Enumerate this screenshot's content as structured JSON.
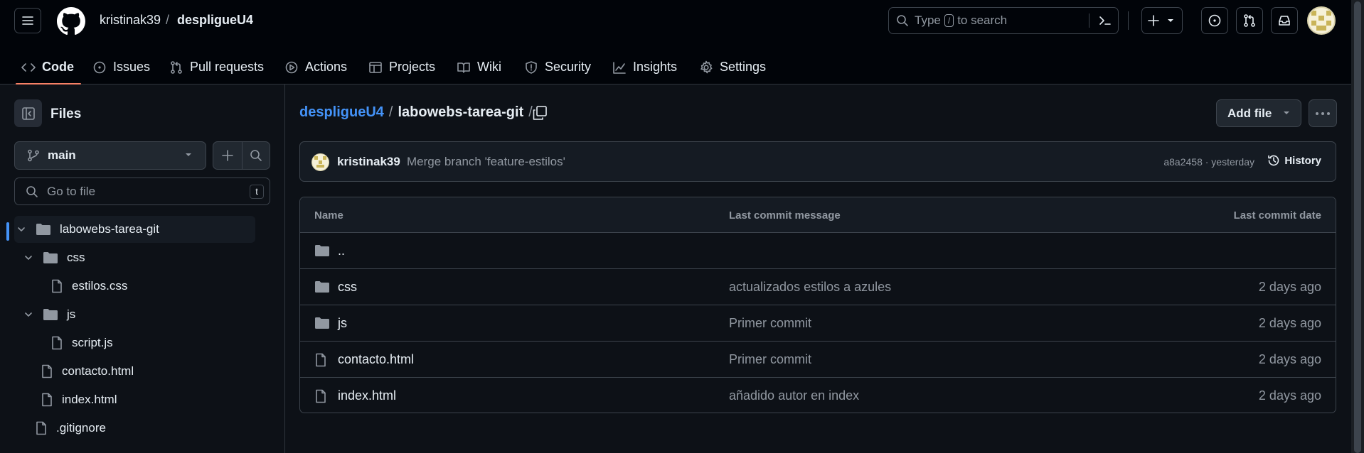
{
  "header": {
    "owner": "kristinak39",
    "separator": "/",
    "repo": "despligueU4",
    "search": {
      "prefix": "Type",
      "key": "/",
      "suffix": "to search"
    }
  },
  "tabs": [
    {
      "label": "Code",
      "icon": "code-icon"
    },
    {
      "label": "Issues",
      "icon": "issue-icon"
    },
    {
      "label": "Pull requests",
      "icon": "pull-request-icon"
    },
    {
      "label": "Actions",
      "icon": "play-icon"
    },
    {
      "label": "Projects",
      "icon": "table-icon"
    },
    {
      "label": "Wiki",
      "icon": "book-icon"
    },
    {
      "label": "Security",
      "icon": "shield-icon"
    },
    {
      "label": "Insights",
      "icon": "graph-icon"
    },
    {
      "label": "Settings",
      "icon": "gear-icon"
    }
  ],
  "sidebar": {
    "title": "Files",
    "branch": "main",
    "goto_placeholder": "Go to file",
    "goto_key": "t",
    "tree": [
      {
        "label": "labowebs-tarea-git",
        "type": "folder"
      },
      {
        "label": "css",
        "type": "folder"
      },
      {
        "label": "estilos.css",
        "type": "file"
      },
      {
        "label": "js",
        "type": "folder"
      },
      {
        "label": "script.js",
        "type": "file"
      },
      {
        "label": "contacto.html",
        "type": "file"
      },
      {
        "label": "index.html",
        "type": "file"
      },
      {
        "label": ".gitignore",
        "type": "file"
      }
    ]
  },
  "main": {
    "path": {
      "owner": "despligueU4",
      "folder": "labowebs-tarea-git",
      "sep": "/"
    },
    "add_file_label": "Add file",
    "commit": {
      "author": "kristinak39",
      "message": "Merge branch 'feature-estilos'",
      "meta": "a8a2458 · yesterday",
      "history_label": "History"
    },
    "table": {
      "headers": {
        "name": "Name",
        "message": "Last commit message",
        "date": "Last commit date"
      },
      "rows": [
        {
          "name": "..",
          "type": "folder",
          "message": "",
          "date": ""
        },
        {
          "name": "css",
          "type": "folder",
          "message": "actualizados estilos a azules",
          "date": "2 days ago"
        },
        {
          "name": "js",
          "type": "folder",
          "message": "Primer commit",
          "date": "2 days ago"
        },
        {
          "name": "contacto.html",
          "type": "file",
          "message": "Primer commit",
          "date": "2 days ago"
        },
        {
          "name": "index.html",
          "type": "file",
          "message": "añadido autor en index",
          "date": "2 days ago"
        }
      ]
    }
  },
  "colors": {
    "accent": "#4493f8",
    "tab_underline": "#f78166",
    "background": "#0d1117"
  }
}
